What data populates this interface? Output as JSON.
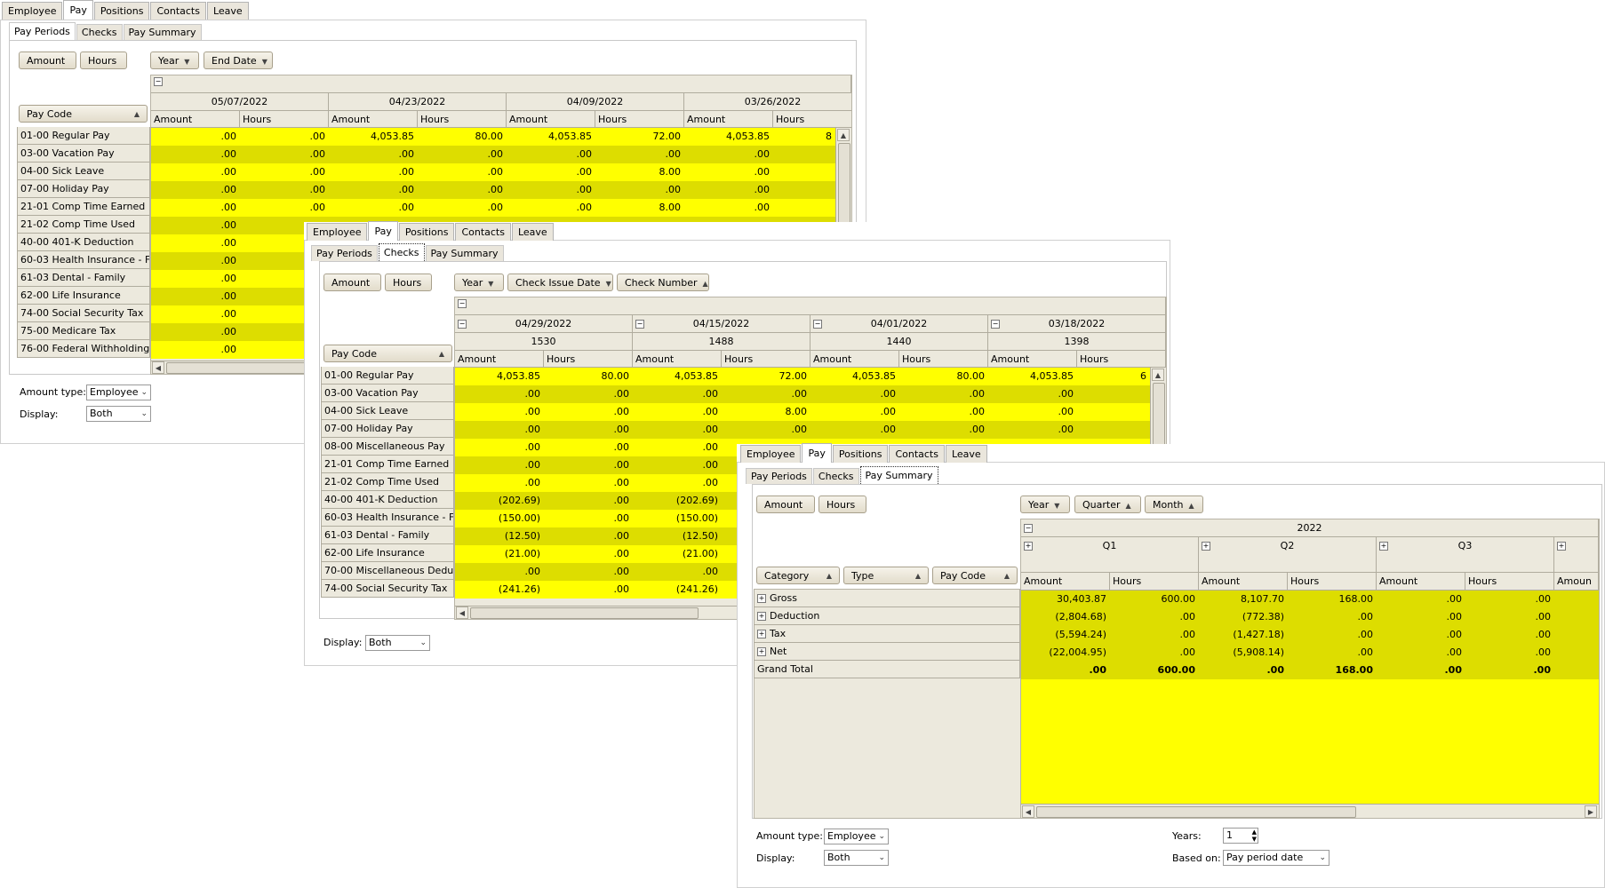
{
  "tabs": [
    "Employee",
    "Pay",
    "Positions",
    "Contacts",
    "Leave"
  ],
  "subtabs": [
    "Pay Periods",
    "Checks",
    "Pay Summary"
  ],
  "measures": [
    "Amount",
    "Hours"
  ],
  "col_labels": {
    "amount": "Amount",
    "hours": "Hours"
  },
  "w1": {
    "filters": [
      "Year",
      "End Date"
    ],
    "rowfield": "Pay Code",
    "dates": [
      "05/07/2022",
      "04/23/2022",
      "04/09/2022",
      "03/26/2022"
    ],
    "rows": [
      {
        "code": "01-00 Regular Pay",
        "v": [
          ".00",
          ".00",
          "4,053.85",
          "80.00",
          "4,053.85",
          "72.00",
          "4,053.85",
          "8"
        ]
      },
      {
        "code": "03-00 Vacation Pay",
        "v": [
          ".00",
          ".00",
          ".00",
          ".00",
          ".00",
          ".00",
          ".00",
          ""
        ]
      },
      {
        "code": "04-00 Sick Leave",
        "v": [
          ".00",
          ".00",
          ".00",
          ".00",
          ".00",
          "8.00",
          ".00",
          ""
        ]
      },
      {
        "code": "07-00 Holiday Pay",
        "v": [
          ".00",
          ".00",
          ".00",
          ".00",
          ".00",
          ".00",
          ".00",
          ""
        ]
      },
      {
        "code": "21-01 Comp Time Earned",
        "v": [
          ".00",
          ".00",
          ".00",
          ".00",
          ".00",
          "8.00",
          ".00",
          ""
        ]
      },
      {
        "code": "21-02 Comp Time Used",
        "v": [
          ".00"
        ]
      },
      {
        "code": "40-00 401-K Deduction",
        "v": [
          ".00"
        ]
      },
      {
        "code": "60-03 Health Insurance - F...",
        "v": [
          ".00"
        ]
      },
      {
        "code": "61-03 Dental - Family",
        "v": [
          ".00"
        ]
      },
      {
        "code": "62-00 Life Insurance",
        "v": [
          ".00"
        ]
      },
      {
        "code": "74-00 Social Security Tax",
        "v": [
          ".00"
        ]
      },
      {
        "code": "75-00 Medicare Tax",
        "v": [
          ".00"
        ]
      },
      {
        "code": "76-00 Federal Withholding ...",
        "v": [
          ".00"
        ]
      }
    ],
    "amount_type_label": "Amount type:",
    "amount_type_value": "Employee",
    "display_label": "Display:",
    "display_value": "Both"
  },
  "w2": {
    "filters": [
      "Year",
      "Check Issue Date",
      "Check Number"
    ],
    "rowfield": "Pay Code",
    "dates": [
      "04/29/2022",
      "04/15/2022",
      "04/01/2022",
      "03/18/2022"
    ],
    "checks": [
      "1530",
      "1488",
      "1440",
      "1398"
    ],
    "rows": [
      {
        "code": "01-00 Regular Pay",
        "v": [
          "4,053.85",
          "80.00",
          "4,053.85",
          "72.00",
          "4,053.85",
          "80.00",
          "4,053.85",
          "6"
        ]
      },
      {
        "code": "03-00 Vacation Pay",
        "v": [
          ".00",
          ".00",
          ".00",
          ".00",
          ".00",
          ".00",
          ".00",
          ""
        ]
      },
      {
        "code": "04-00 Sick Leave",
        "v": [
          ".00",
          ".00",
          ".00",
          "8.00",
          ".00",
          ".00",
          ".00",
          ""
        ]
      },
      {
        "code": "07-00 Holiday Pay",
        "v": [
          ".00",
          ".00",
          ".00",
          ".00",
          ".00",
          ".00",
          ".00",
          ""
        ]
      },
      {
        "code": "08-00 Miscellaneous Pay",
        "v": [
          ".00",
          ".00",
          ".00"
        ]
      },
      {
        "code": "21-01 Comp Time Earned",
        "v": [
          ".00",
          ".00",
          ".00"
        ]
      },
      {
        "code": "21-02 Comp Time Used",
        "v": [
          ".00",
          ".00",
          ".00"
        ]
      },
      {
        "code": "40-00 401-K Deduction",
        "v": [
          "(202.69)",
          ".00",
          "(202.69)"
        ]
      },
      {
        "code": "60-03 Health Insurance - F...",
        "v": [
          "(150.00)",
          ".00",
          "(150.00)"
        ]
      },
      {
        "code": "61-03 Dental - Family",
        "v": [
          "(12.50)",
          ".00",
          "(12.50)"
        ]
      },
      {
        "code": "62-00 Life Insurance",
        "v": [
          "(21.00)",
          ".00",
          "(21.00)"
        ]
      },
      {
        "code": "70-00 Miscellaneous Deduct...",
        "v": [
          ".00",
          ".00",
          ".00"
        ]
      },
      {
        "code": "74-00 Social Security Tax",
        "v": [
          "(241.26)",
          ".00",
          "(241.26)"
        ]
      }
    ],
    "display_label": "Display:",
    "display_value": "Both"
  },
  "w3": {
    "filters": [
      "Year",
      "Quarter",
      "Month"
    ],
    "rowfields": [
      "Category",
      "Type",
      "Pay Code"
    ],
    "year": "2022",
    "quarters": [
      "Q1",
      "Q2",
      "Q3"
    ],
    "partial_col": "Amoun",
    "rows": [
      {
        "cat": "Gross",
        "v": [
          "30,403.87",
          "600.00",
          "8,107.70",
          "168.00",
          ".00",
          ".00"
        ]
      },
      {
        "cat": "Deduction",
        "v": [
          "(2,804.68)",
          ".00",
          "(772.38)",
          ".00",
          ".00",
          ".00"
        ]
      },
      {
        "cat": "Tax",
        "v": [
          "(5,594.24)",
          ".00",
          "(1,427.18)",
          ".00",
          ".00",
          ".00"
        ]
      },
      {
        "cat": "Net",
        "v": [
          "(22,004.95)",
          ".00",
          "(5,908.14)",
          ".00",
          ".00",
          ".00"
        ]
      }
    ],
    "grand_total_label": "Grand Total",
    "grand_total": [
      ".00",
      "600.00",
      ".00",
      "168.00",
      ".00",
      ".00"
    ],
    "amount_type_label": "Amount type:",
    "amount_type_value": "Employee",
    "display_label": "Display:",
    "display_value": "Both",
    "years_label": "Years:",
    "years_value": "1",
    "based_on_label": "Based on:",
    "based_on_value": "Pay period date"
  }
}
